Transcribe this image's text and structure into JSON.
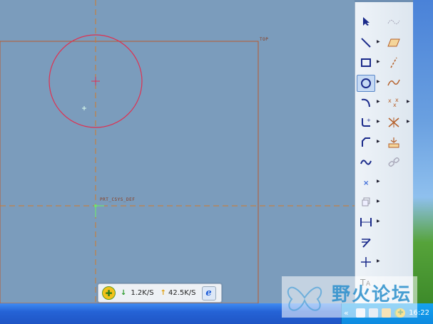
{
  "canvas": {
    "top_datum_label": "TOP",
    "csys_label": "PRT_CSYS_DEF"
  },
  "toolbar": {
    "rows": [
      {
        "left": "select-arrow-icon",
        "right": "dashed-spline-icon"
      },
      {
        "left": "line-icon",
        "right": "parallelogram-icon"
      },
      {
        "left": "rectangle-icon",
        "right": "dashed-line-icon"
      },
      {
        "left": "circle-icon",
        "right": "spline-icon"
      },
      {
        "left": "arc-icon",
        "right": "point-icon"
      },
      {
        "left": "fillet-icon",
        "right": "trim-icon"
      },
      {
        "left": "chamfer-icon",
        "right": "constraint-icon"
      },
      {
        "left": "spline-icon",
        "right": "chain-icon"
      },
      {
        "left": "point-x-icon",
        "right": ""
      },
      {
        "left": "offset-icon",
        "right": ""
      },
      {
        "left": "dimension-icon",
        "right": ""
      },
      {
        "left": "modify-icon",
        "right": ""
      },
      {
        "left": "centerline-icon",
        "right": ""
      },
      {
        "left": "text-icon",
        "right": ""
      }
    ]
  },
  "net_meter": {
    "down_speed": "1.2K/S",
    "up_speed": "42.5K/S"
  },
  "watermark": {
    "text": "野火论坛"
  },
  "taskbar": {
    "clock": "16:22"
  },
  "colors": {
    "canvas": "#7b9cbc",
    "datum": "#c8702a",
    "circle": "#e03050"
  }
}
